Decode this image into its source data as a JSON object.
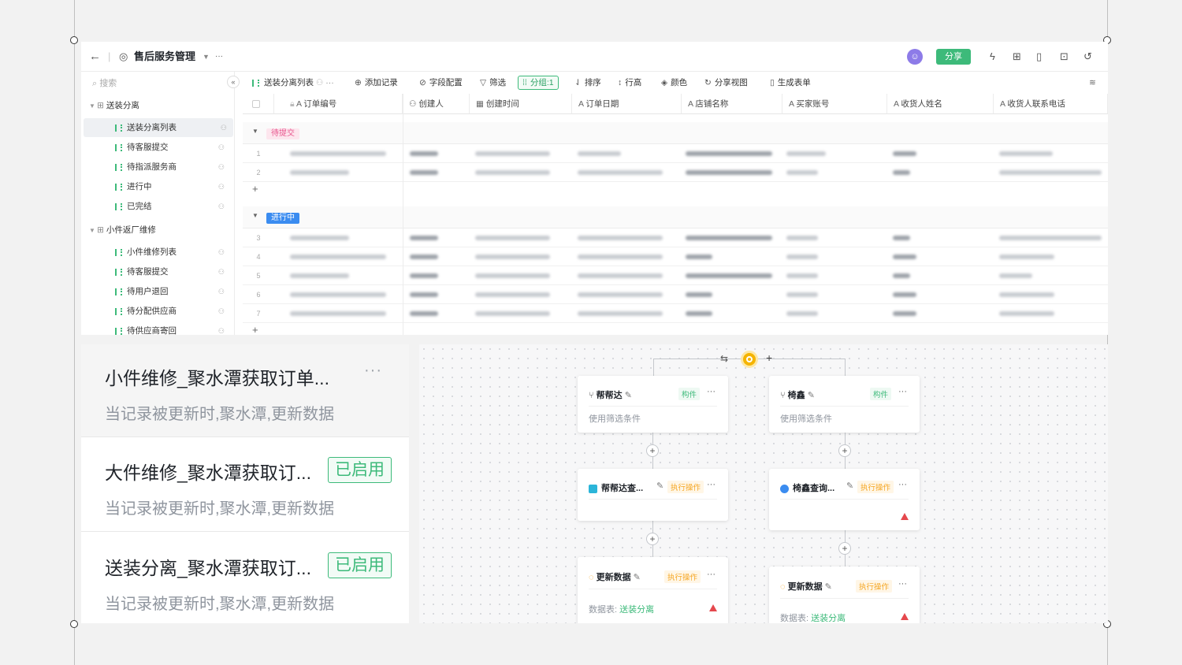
{
  "app": {
    "title": "售后服务管理",
    "share_label": "分享",
    "back_label": "←",
    "more_label": "···"
  },
  "sidebar": {
    "search_placeholder": "搜索",
    "groups": [
      {
        "label": "送装分离",
        "items": [
          "送装分离列表",
          "待客服提交",
          "待指派服务商",
          "进行中",
          "已完结"
        ]
      },
      {
        "label": "小件返厂维修",
        "items": [
          "小件维修列表",
          "待客服提交",
          "待用户退回",
          "待分配供应商",
          "待供应商寄回"
        ]
      }
    ]
  },
  "toolbar": {
    "view_name": "送装分离列表",
    "add_record": "添加记录",
    "field_config": "字段配置",
    "filter": "筛选",
    "group": "分组:1",
    "sort": "排序",
    "row_height": "行高",
    "color": "颜色",
    "share_view": "分享视图",
    "generate_form": "生成表单"
  },
  "grid": {
    "columns": [
      "订单编号",
      "创建人",
      "创建时间",
      "订单日期",
      "店铺名称",
      "买家账号",
      "收货人姓名",
      "收货人联系电话"
    ],
    "groups": [
      {
        "tag": "待提交",
        "rows": [
          "1",
          "2"
        ]
      },
      {
        "tag": "进行中",
        "rows": [
          "3",
          "4",
          "5",
          "6",
          "7"
        ]
      }
    ]
  },
  "automations": [
    {
      "title": "小件维修_聚水潭获取订单...",
      "subtitle": "当记录被更新时,聚水潭,更新数据",
      "status": "",
      "more": "···"
    },
    {
      "title": "大件维修_聚水潭获取订...",
      "subtitle": "当记录被更新时,聚水潭,更新数据",
      "status": "已启用"
    },
    {
      "title": "送装分离_聚水潭获取订...",
      "subtitle": "当记录被更新时,聚水潭,更新数据",
      "status": "已启用"
    }
  ],
  "flow": {
    "branches": [
      {
        "condition": {
          "title": "帮帮达",
          "kind": "构件",
          "body": "使用筛选条件"
        },
        "query": {
          "title": "帮帮达查...",
          "kind": "执行操作"
        },
        "update": {
          "title": "更新数据",
          "kind": "执行操作",
          "table_label": "数据表:",
          "table": "送装分离"
        }
      },
      {
        "condition": {
          "title": "椅鑫",
          "kind": "构件",
          "body": "使用筛选条件"
        },
        "query": {
          "title": "椅鑫查询...",
          "kind": "执行操作"
        },
        "update": {
          "title": "更新数据",
          "kind": "执行操作",
          "table_label": "数据表:",
          "table": "送装分离"
        }
      }
    ]
  },
  "colors": {
    "accent": "#3dba7a",
    "warning": "#f5a623",
    "danger": "#e5484d",
    "tag_pending": "#e8578e",
    "tag_progress": "#3b8cf0"
  }
}
